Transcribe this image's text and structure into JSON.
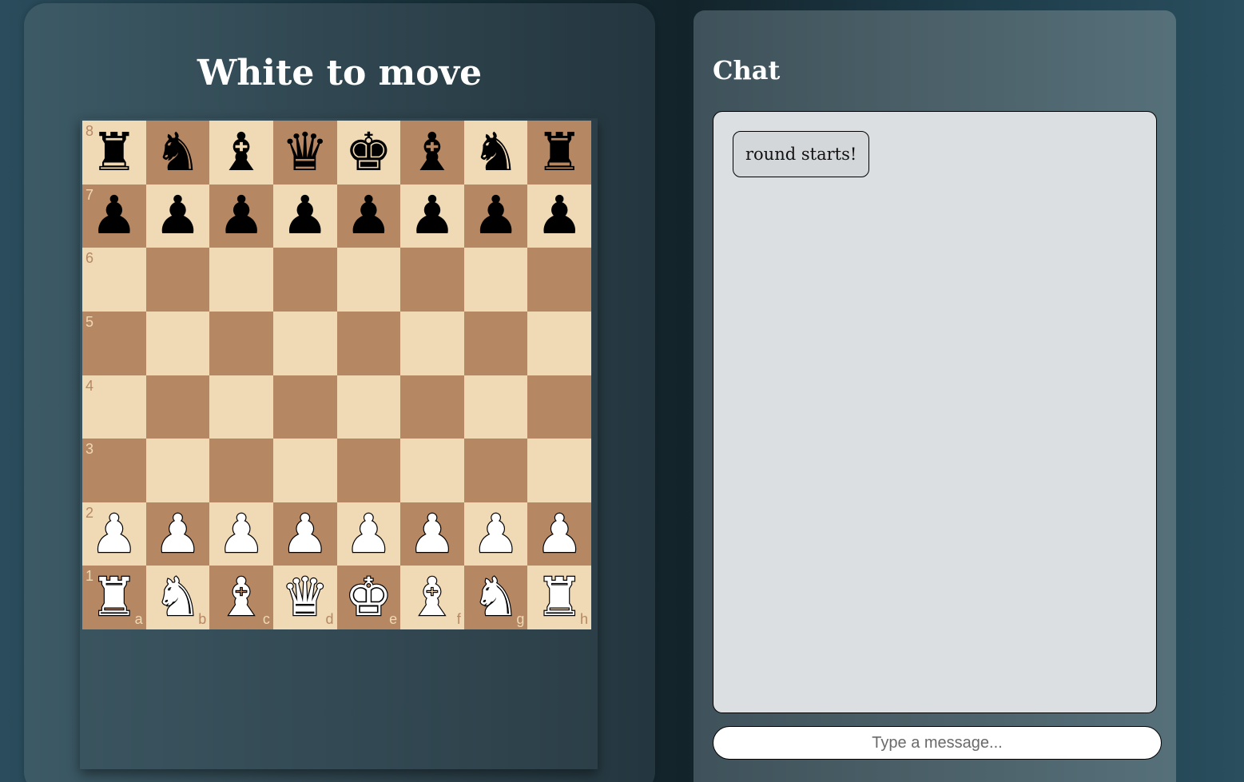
{
  "game": {
    "status": "White to move",
    "files": [
      "a",
      "b",
      "c",
      "d",
      "e",
      "f",
      "g",
      "h"
    ],
    "ranks": [
      "8",
      "7",
      "6",
      "5",
      "4",
      "3",
      "2",
      "1"
    ],
    "position": [
      [
        "br",
        "bn",
        "bb",
        "bq",
        "bk",
        "bb",
        "bn",
        "br"
      ],
      [
        "bp",
        "bp",
        "bp",
        "bp",
        "bp",
        "bp",
        "bp",
        "bp"
      ],
      [
        "",
        "",
        "",
        "",
        "",
        "",
        "",
        ""
      ],
      [
        "",
        "",
        "",
        "",
        "",
        "",
        "",
        ""
      ],
      [
        "",
        "",
        "",
        "",
        "",
        "",
        "",
        ""
      ],
      [
        "",
        "",
        "",
        "",
        "",
        "",
        "",
        ""
      ],
      [
        "wp",
        "wp",
        "wp",
        "wp",
        "wp",
        "wp",
        "wp",
        "wp"
      ],
      [
        "wr",
        "wn",
        "wb",
        "wq",
        "wk",
        "wb",
        "wn",
        "wr"
      ]
    ],
    "piece_glyphs": {
      "k": "♚",
      "q": "♛",
      "r": "♜",
      "b": "♝",
      "n": "♞",
      "p": "♟"
    },
    "piece_names": {
      "k": "king",
      "q": "queen",
      "r": "rook",
      "b": "bishop",
      "n": "knight",
      "p": "pawn"
    },
    "colors": {
      "light_square": "#f0d9b5",
      "dark_square": "#b58863"
    }
  },
  "chat": {
    "title": "Chat",
    "messages": [
      "round starts!"
    ],
    "input_value": "",
    "input_placeholder": "Type a message..."
  }
}
